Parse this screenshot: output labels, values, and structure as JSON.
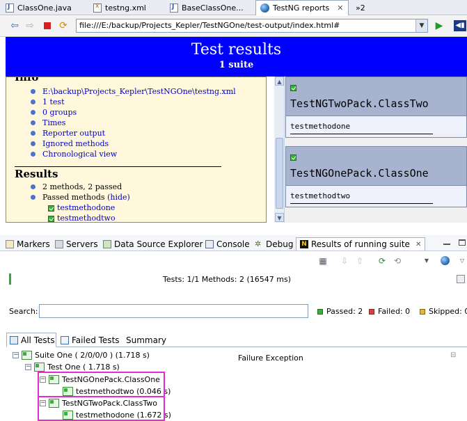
{
  "editor_tabs": [
    {
      "label": "ClassOne.java",
      "icon": "java-file-icon"
    },
    {
      "label": "testng.xml",
      "icon": "xml-file-icon"
    },
    {
      "label": "BaseClassOne...",
      "icon": "java-file-icon"
    },
    {
      "label": "TestNG reports",
      "icon": "globe-icon",
      "close": "✕"
    },
    {
      "label": "»2",
      "icon": "overflow-icon"
    }
  ],
  "browser": {
    "url": "file:///E:/backup/Projects_Kepler/TestNGOne/test-output/index.html#"
  },
  "report": {
    "title": "Test results",
    "subtitle": "1 suite",
    "info_heading": "Info",
    "info_links": [
      "E:\\backup\\Projects_Kepler\\TestNGOne\\testng.xml",
      "1 test",
      "0 groups",
      "Times",
      "Reporter output",
      "Ignored methods",
      "Chronological view"
    ],
    "results_heading": "Results",
    "methods_summary": "2 methods, 2 passed",
    "passed_methods_label": "Passed methods",
    "hide_link": "(hide)",
    "passed_methods": [
      "testmethodone",
      "testmethodtwo"
    ],
    "classes": [
      {
        "name": "TestNGTwoPack.ClassTwo",
        "method": "testmethodone"
      },
      {
        "name": "TestNGOnePack.ClassOne",
        "method": "testmethodtwo"
      }
    ]
  },
  "view_tabs": [
    {
      "label": "Markers"
    },
    {
      "label": "Servers"
    },
    {
      "label": "Data Source Explorer"
    },
    {
      "label": "Console"
    },
    {
      "label": "Debug"
    },
    {
      "label": "Results of running suite",
      "close": "✕"
    }
  ],
  "progress": {
    "text": "Tests: 1/1  Methods: 2 (16547 ms)",
    "fraction": 0.005
  },
  "search": {
    "label": "Search:",
    "value": ""
  },
  "counts": {
    "passed": "Passed: 2",
    "failed": "Failed: 0",
    "skipped": "Skipped: 0"
  },
  "result_tabs": [
    "All Tests",
    "Failed Tests",
    "Summary"
  ],
  "tree": {
    "suite": "Suite One ( 2/0/0/0 ) (1.718 s)",
    "test": "Test One ( 1.718 s)",
    "class_one": "TestNGOnePack.ClassOne",
    "class_one_method": "testmethodtwo  (0.046 s)",
    "class_two": "TestNGTwoPack.ClassTwo",
    "class_two_method": "testmethodone  (1.672 s)"
  },
  "failure_exception": "Failure Exception",
  "colors": {
    "banner": "#0000ff",
    "nav_background": "#fff8dc",
    "pass_green": "#3cae3c",
    "highlight": "#e42ad0"
  }
}
